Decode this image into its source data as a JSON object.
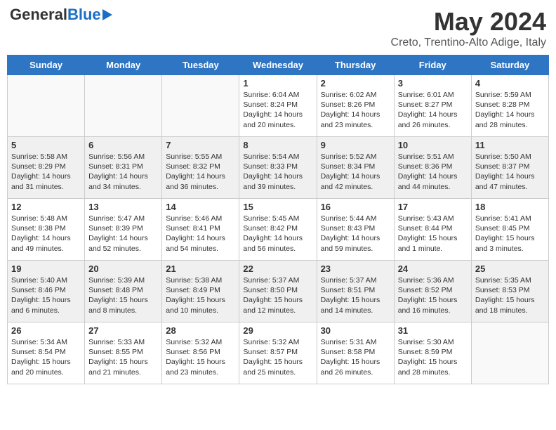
{
  "header": {
    "logo_general": "General",
    "logo_blue": "Blue",
    "logo_underline": "Blue",
    "main_title": "May 2024",
    "subtitle": "Creto, Trentino-Alto Adige, Italy"
  },
  "days_of_week": [
    "Sunday",
    "Monday",
    "Tuesday",
    "Wednesday",
    "Thursday",
    "Friday",
    "Saturday"
  ],
  "weeks": [
    {
      "row_shade": false,
      "days": [
        {
          "num": "",
          "text": ""
        },
        {
          "num": "",
          "text": ""
        },
        {
          "num": "",
          "text": ""
        },
        {
          "num": "1",
          "text": "Sunrise: 6:04 AM\nSunset: 8:24 PM\nDaylight: 14 hours and 20 minutes."
        },
        {
          "num": "2",
          "text": "Sunrise: 6:02 AM\nSunset: 8:26 PM\nDaylight: 14 hours and 23 minutes."
        },
        {
          "num": "3",
          "text": "Sunrise: 6:01 AM\nSunset: 8:27 PM\nDaylight: 14 hours and 26 minutes."
        },
        {
          "num": "4",
          "text": "Sunrise: 5:59 AM\nSunset: 8:28 PM\nDaylight: 14 hours and 28 minutes."
        }
      ]
    },
    {
      "row_shade": true,
      "days": [
        {
          "num": "5",
          "text": "Sunrise: 5:58 AM\nSunset: 8:29 PM\nDaylight: 14 hours and 31 minutes."
        },
        {
          "num": "6",
          "text": "Sunrise: 5:56 AM\nSunset: 8:31 PM\nDaylight: 14 hours and 34 minutes."
        },
        {
          "num": "7",
          "text": "Sunrise: 5:55 AM\nSunset: 8:32 PM\nDaylight: 14 hours and 36 minutes."
        },
        {
          "num": "8",
          "text": "Sunrise: 5:54 AM\nSunset: 8:33 PM\nDaylight: 14 hours and 39 minutes."
        },
        {
          "num": "9",
          "text": "Sunrise: 5:52 AM\nSunset: 8:34 PM\nDaylight: 14 hours and 42 minutes."
        },
        {
          "num": "10",
          "text": "Sunrise: 5:51 AM\nSunset: 8:36 PM\nDaylight: 14 hours and 44 minutes."
        },
        {
          "num": "11",
          "text": "Sunrise: 5:50 AM\nSunset: 8:37 PM\nDaylight: 14 hours and 47 minutes."
        }
      ]
    },
    {
      "row_shade": false,
      "days": [
        {
          "num": "12",
          "text": "Sunrise: 5:48 AM\nSunset: 8:38 PM\nDaylight: 14 hours and 49 minutes."
        },
        {
          "num": "13",
          "text": "Sunrise: 5:47 AM\nSunset: 8:39 PM\nDaylight: 14 hours and 52 minutes."
        },
        {
          "num": "14",
          "text": "Sunrise: 5:46 AM\nSunset: 8:41 PM\nDaylight: 14 hours and 54 minutes."
        },
        {
          "num": "15",
          "text": "Sunrise: 5:45 AM\nSunset: 8:42 PM\nDaylight: 14 hours and 56 minutes."
        },
        {
          "num": "16",
          "text": "Sunrise: 5:44 AM\nSunset: 8:43 PM\nDaylight: 14 hours and 59 minutes."
        },
        {
          "num": "17",
          "text": "Sunrise: 5:43 AM\nSunset: 8:44 PM\nDaylight: 15 hours and 1 minute."
        },
        {
          "num": "18",
          "text": "Sunrise: 5:41 AM\nSunset: 8:45 PM\nDaylight: 15 hours and 3 minutes."
        }
      ]
    },
    {
      "row_shade": true,
      "days": [
        {
          "num": "19",
          "text": "Sunrise: 5:40 AM\nSunset: 8:46 PM\nDaylight: 15 hours and 6 minutes."
        },
        {
          "num": "20",
          "text": "Sunrise: 5:39 AM\nSunset: 8:48 PM\nDaylight: 15 hours and 8 minutes."
        },
        {
          "num": "21",
          "text": "Sunrise: 5:38 AM\nSunset: 8:49 PM\nDaylight: 15 hours and 10 minutes."
        },
        {
          "num": "22",
          "text": "Sunrise: 5:37 AM\nSunset: 8:50 PM\nDaylight: 15 hours and 12 minutes."
        },
        {
          "num": "23",
          "text": "Sunrise: 5:37 AM\nSunset: 8:51 PM\nDaylight: 15 hours and 14 minutes."
        },
        {
          "num": "24",
          "text": "Sunrise: 5:36 AM\nSunset: 8:52 PM\nDaylight: 15 hours and 16 minutes."
        },
        {
          "num": "25",
          "text": "Sunrise: 5:35 AM\nSunset: 8:53 PM\nDaylight: 15 hours and 18 minutes."
        }
      ]
    },
    {
      "row_shade": false,
      "days": [
        {
          "num": "26",
          "text": "Sunrise: 5:34 AM\nSunset: 8:54 PM\nDaylight: 15 hours and 20 minutes."
        },
        {
          "num": "27",
          "text": "Sunrise: 5:33 AM\nSunset: 8:55 PM\nDaylight: 15 hours and 21 minutes."
        },
        {
          "num": "28",
          "text": "Sunrise: 5:32 AM\nSunset: 8:56 PM\nDaylight: 15 hours and 23 minutes."
        },
        {
          "num": "29",
          "text": "Sunrise: 5:32 AM\nSunset: 8:57 PM\nDaylight: 15 hours and 25 minutes."
        },
        {
          "num": "30",
          "text": "Sunrise: 5:31 AM\nSunset: 8:58 PM\nDaylight: 15 hours and 26 minutes."
        },
        {
          "num": "31",
          "text": "Sunrise: 5:30 AM\nSunset: 8:59 PM\nDaylight: 15 hours and 28 minutes."
        },
        {
          "num": "",
          "text": ""
        }
      ]
    }
  ]
}
